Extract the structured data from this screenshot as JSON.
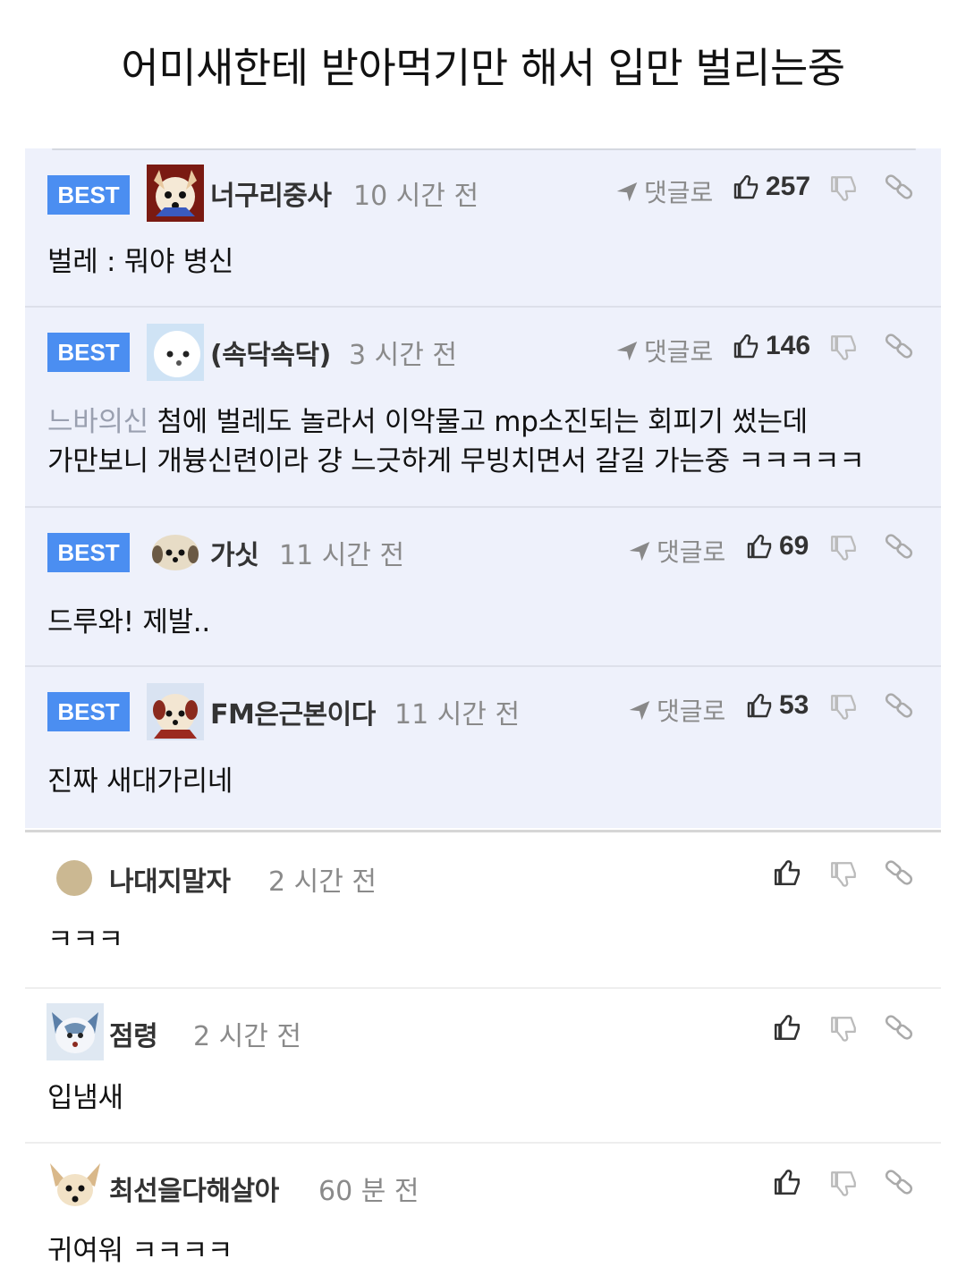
{
  "title": "어미새한테 받아먹기만 해서 입만 벌리는중",
  "labels": {
    "best": "BEST",
    "reply": "댓글로"
  },
  "colors": {
    "best_badge": "#4b8ef1",
    "best_background": "#eef1fb"
  },
  "best_comments": [
    {
      "nick": "너구리중사",
      "time": "10 시간 전",
      "likes": "257",
      "text": "벌레 : 뭐야 병신",
      "avatar": "dog-avatar"
    },
    {
      "nick": "(속닥속닥)",
      "time": "3 시간 전",
      "likes": "146",
      "mention": "느바의신",
      "text": "첨에 벌레도 놀라서 이악물고 mp소진되는 회피기 썼는데",
      "text2": "가만보니 개븅신련이라 걍 느긋하게 무빙치면서 갈길 가는중 ㅋㅋㅋㅋㅋ",
      "avatar": "white-dog-avatar"
    },
    {
      "nick": "가싯",
      "time": "11 시간 전",
      "likes": "69",
      "text": "드루와! 제발..",
      "avatar": "puppy-avatar"
    },
    {
      "nick": "FM은근본이다",
      "time": "11 시간 전",
      "likes": "53",
      "text": "진짜 새대가리네",
      "avatar": "dog-avatar"
    }
  ],
  "comments": [
    {
      "nick": "나대지말자",
      "time": "2 시간 전",
      "text": "ㅋㅋㅋ",
      "avatar": "default-avatar"
    },
    {
      "nick": "점령",
      "time": "2 시간 전",
      "text": "입냄새",
      "avatar": "husky-avatar"
    },
    {
      "nick": "최선을다해살아",
      "time": "60 분 전",
      "text": "귀여워 ㅋㅋㅋㅋ",
      "avatar": "chihuahua-avatar"
    }
  ]
}
